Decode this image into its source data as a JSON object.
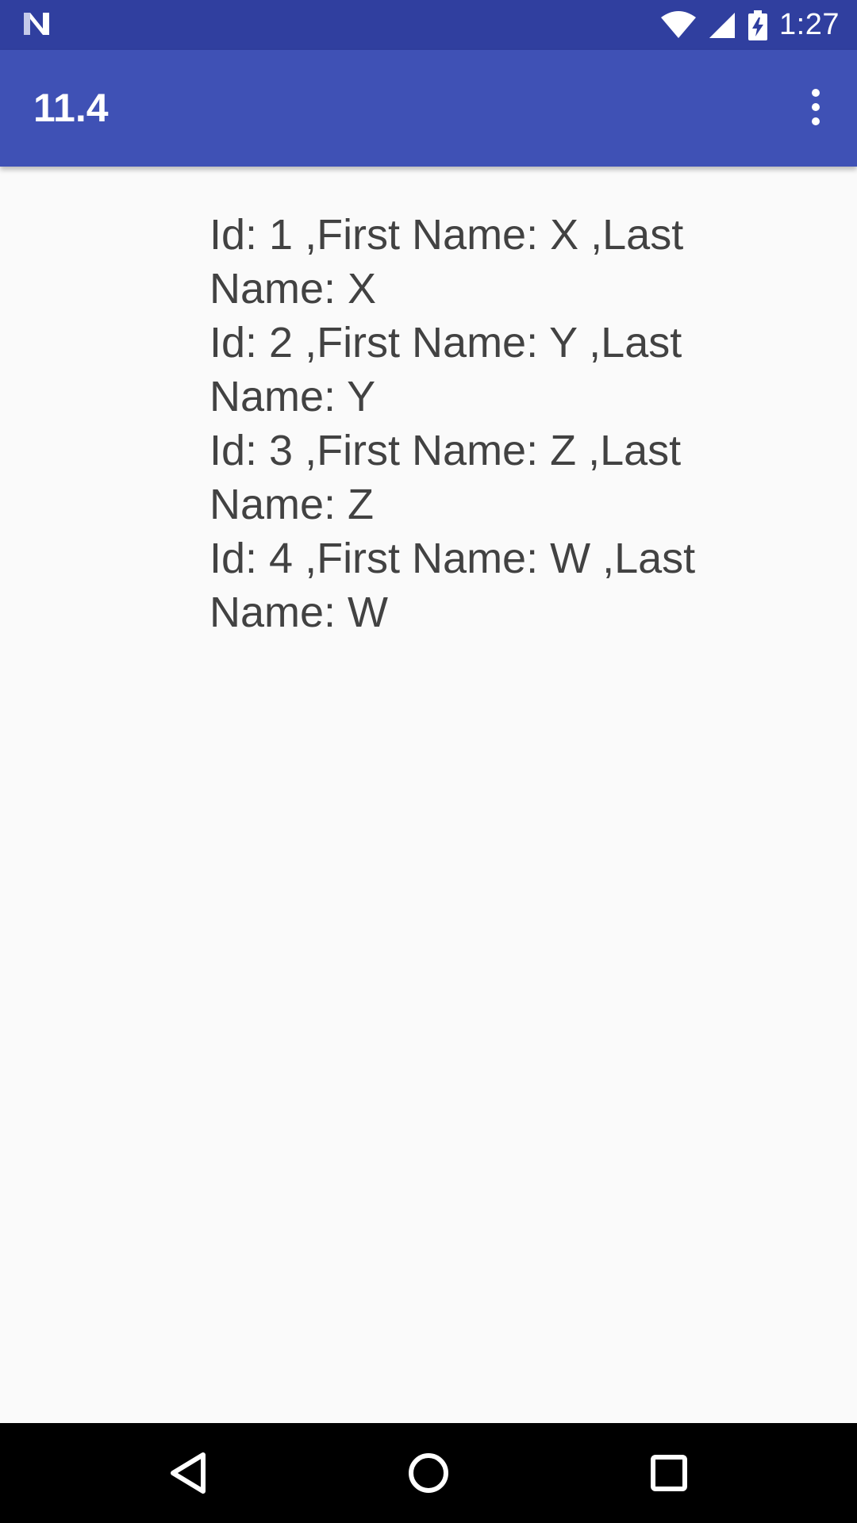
{
  "status_bar": {
    "time": "1:27",
    "icons": [
      "android-n-icon",
      "wifi-icon",
      "cell-signal-icon",
      "battery-charging-icon"
    ]
  },
  "app_bar": {
    "title": "11.4",
    "overflow_icon": "more-vert-icon"
  },
  "content": {
    "records": [
      "Id: 1 ,First Name: X ,Last Name: X",
      "Id: 2 ,First Name: Y ,Last Name: Y",
      "Id: 3 ,First Name: Z ,Last Name: Z",
      "Id: 4 ,First Name: W ,Last Name: W"
    ]
  },
  "nav_bar": {
    "buttons": [
      "back-icon",
      "home-icon",
      "recents-icon"
    ]
  },
  "colors": {
    "status_bar": "#303f9f",
    "app_bar": "#3f51b5",
    "background": "#fafafa",
    "text": "#424242",
    "nav_bar": "#000000"
  }
}
